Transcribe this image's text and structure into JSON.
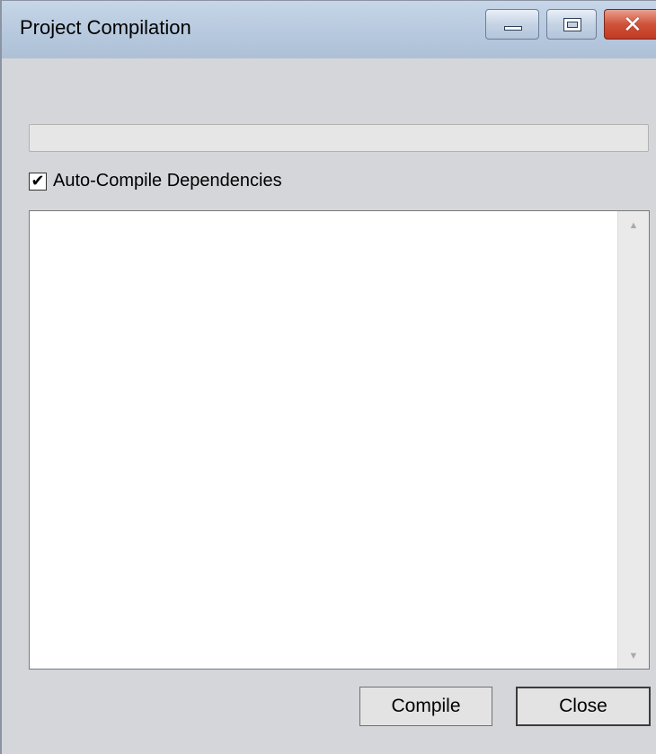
{
  "window": {
    "title": "Project Compilation",
    "controls": {
      "minimize_icon": "minimize-icon",
      "maximize_icon": "maximize-icon",
      "close_icon": "close-icon",
      "close_glyph": "✕"
    }
  },
  "progress": {
    "value": 0
  },
  "options": {
    "auto_compile_label": "Auto-Compile Dependencies",
    "auto_compile_checked": true,
    "check_glyph": "✔"
  },
  "output": {
    "text": ""
  },
  "scrollbar": {
    "up_glyph": "▲",
    "down_glyph": "▼"
  },
  "buttons": {
    "compile_label": "Compile",
    "close_label": "Close"
  }
}
